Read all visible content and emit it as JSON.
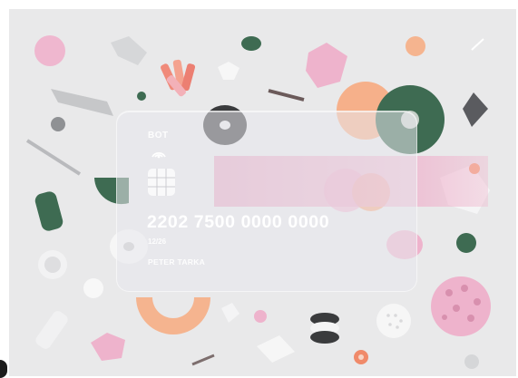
{
  "card": {
    "bank_label": "BOT",
    "number": "2202 7500 0000 0000",
    "expiry": "12/26",
    "holder": "PETER TARKA"
  },
  "icons": {
    "contactless": "contactless-wave-icon",
    "chip": "card-chip-icon"
  },
  "colors": {
    "background": "#e9e9ea",
    "pink": "#eeb3cc",
    "green": "#3e6b52",
    "peach": "#f5b48f",
    "gray": "#9c9ea3"
  }
}
